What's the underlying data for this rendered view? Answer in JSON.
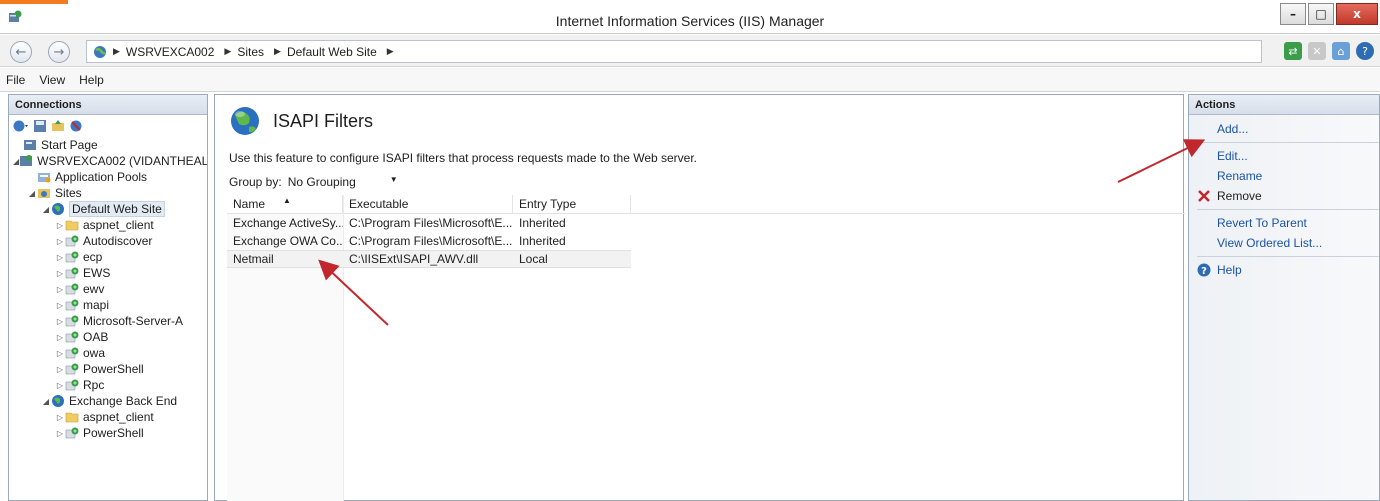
{
  "window": {
    "title": "Internet Information Services (IIS) Manager",
    "min": "–",
    "max": "□",
    "close": "x"
  },
  "addressbar": {
    "crumbs": [
      "WSRVEXCA002",
      "Sites",
      "Default Web Site"
    ]
  },
  "menu": [
    "File",
    "View",
    "Help"
  ],
  "connections": {
    "header": "Connections",
    "tree": [
      {
        "label": "Start Page",
        "level": 0,
        "icon": "start-page-icon"
      },
      {
        "label": "WSRVEXCA002 (VIDANTHEAL",
        "level": 0,
        "icon": "server-icon"
      },
      {
        "label": "Application Pools",
        "level": 1,
        "icon": "app-pools-icon"
      },
      {
        "label": "Sites",
        "level": 1,
        "icon": "sites-folder-icon"
      },
      {
        "label": "Default Web Site",
        "level": 2,
        "icon": "globe-icon",
        "selected": true
      },
      {
        "label": "aspnet_client",
        "level": 3,
        "icon": "folder-icon"
      },
      {
        "label": "Autodiscover",
        "level": 3,
        "icon": "app-icon"
      },
      {
        "label": "ecp",
        "level": 3,
        "icon": "app-icon"
      },
      {
        "label": "EWS",
        "level": 3,
        "icon": "app-icon"
      },
      {
        "label": "ewv",
        "level": 3,
        "icon": "app-icon"
      },
      {
        "label": "mapi",
        "level": 3,
        "icon": "app-icon"
      },
      {
        "label": "Microsoft-Server-A",
        "level": 3,
        "icon": "app-icon"
      },
      {
        "label": "OAB",
        "level": 3,
        "icon": "app-icon"
      },
      {
        "label": "owa",
        "level": 3,
        "icon": "app-icon"
      },
      {
        "label": "PowerShell",
        "level": 3,
        "icon": "app-icon"
      },
      {
        "label": "Rpc",
        "level": 3,
        "icon": "app-icon"
      },
      {
        "label": "Exchange Back End",
        "level": 2,
        "icon": "globe-icon"
      },
      {
        "label": "aspnet_client",
        "level": 3,
        "icon": "folder-icon"
      },
      {
        "label": "PowerShell",
        "level": 3,
        "icon": "app-icon"
      }
    ]
  },
  "feature": {
    "title": "ISAPI Filters",
    "description": "Use this feature to configure ISAPI filters that process requests made to the Web server.",
    "groupby_label": "Group by:",
    "groupby_value": "No Grouping",
    "columns": [
      "Name",
      "Executable",
      "Entry Type"
    ],
    "rows": [
      [
        "Exchange ActiveSy...",
        "C:\\Program Files\\Microsoft\\E...",
        "Inherited"
      ],
      [
        "Exchange OWA Co...",
        "C:\\Program Files\\Microsoft\\E...",
        "Inherited"
      ],
      [
        "Netmail",
        "C:\\IISExt\\ISAPI_AWV.dll",
        "Local"
      ]
    ]
  },
  "actions": {
    "header": "Actions",
    "add": "Add...",
    "edit": "Edit...",
    "rename": "Rename",
    "remove": "Remove",
    "revert": "Revert To Parent",
    "ordered": "View Ordered List...",
    "help": "Help"
  },
  "colors": {
    "accent_link": "#1a53a8",
    "arrow": "#c0282d",
    "close_button": "#c0392b"
  }
}
